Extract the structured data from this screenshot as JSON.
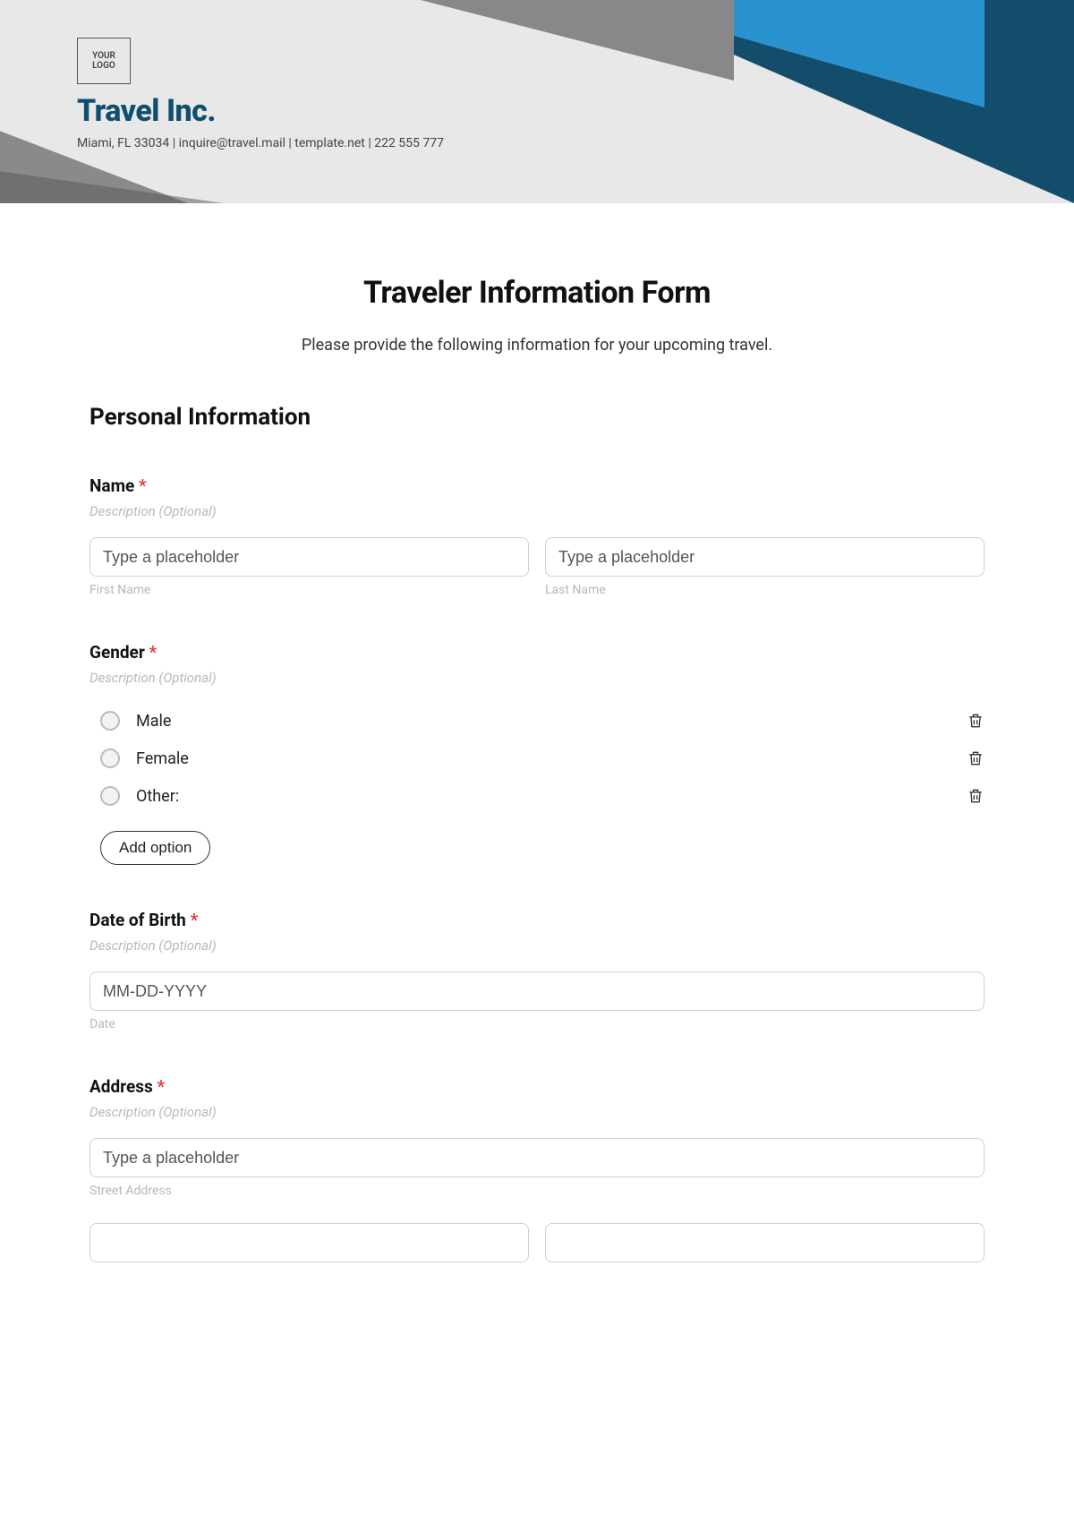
{
  "header": {
    "logo_text": "YOUR\nLOGO",
    "company_name": "Travel Inc.",
    "meta": "Miami, FL 33034 | inquire@travel.mail | template.net | 222 555 777"
  },
  "form": {
    "title": "Traveler Information Form",
    "subtitle": "Please provide the following information for your upcoming travel.",
    "section_personal": "Personal Information"
  },
  "fields": {
    "name": {
      "label": "Name",
      "desc": "Description (Optional)",
      "first_ph": "Type a placeholder",
      "last_ph": "Type a placeholder",
      "first_sub": "First Name",
      "last_sub": "Last Name"
    },
    "gender": {
      "label": "Gender",
      "desc": "Description (Optional)",
      "options": [
        "Male",
        "Female",
        "Other:"
      ],
      "add_option": "Add option"
    },
    "dob": {
      "label": "Date of Birth",
      "desc": "Description (Optional)",
      "ph": "MM-DD-YYYY",
      "sub": "Date"
    },
    "address": {
      "label": "Address",
      "desc": "Description (Optional)",
      "street_ph": "Type a placeholder",
      "street_sub": "Street Address"
    }
  },
  "required_marker": "*"
}
